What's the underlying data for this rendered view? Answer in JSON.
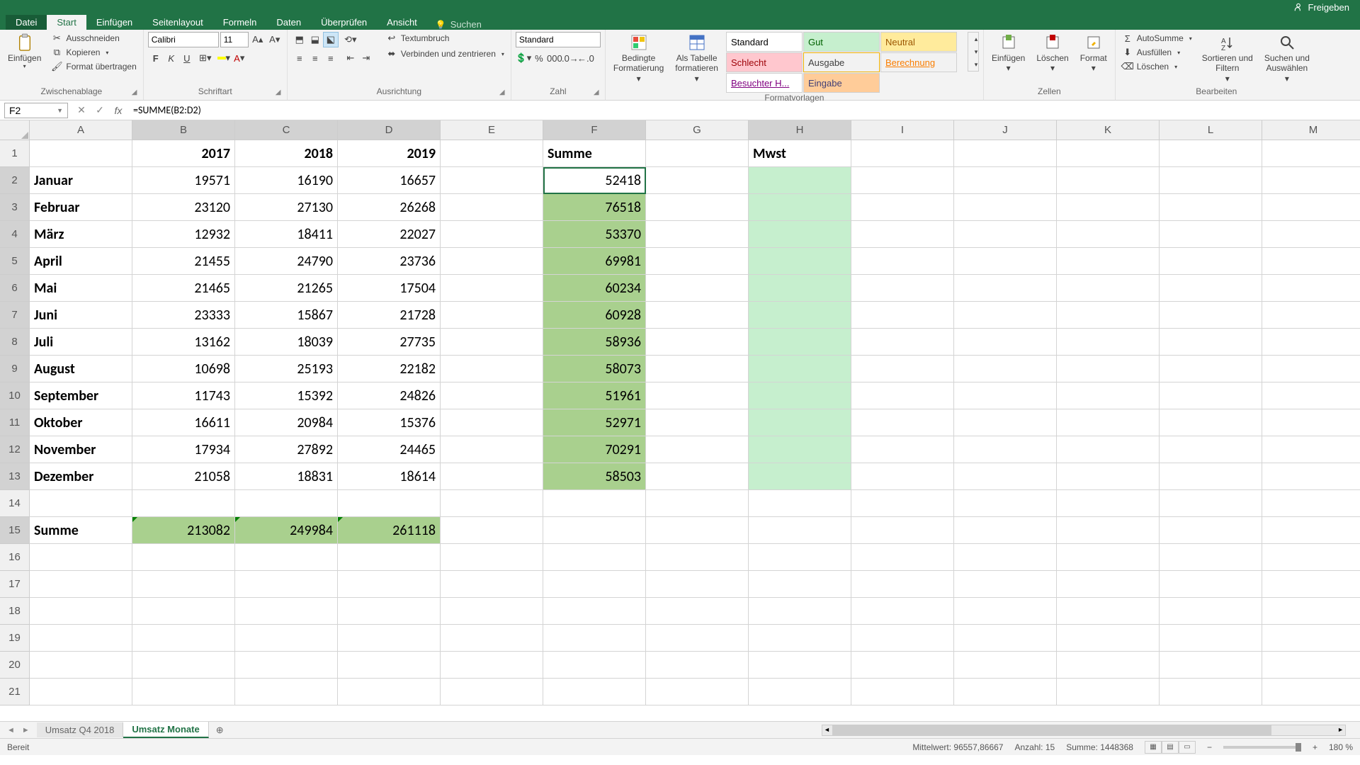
{
  "titlebar": {
    "share": "Freigeben"
  },
  "tabs": {
    "file": "Datei",
    "start": "Start",
    "insert": "Einfügen",
    "pagelayout": "Seitenlayout",
    "formulas": "Formeln",
    "data": "Daten",
    "review": "Überprüfen",
    "view": "Ansicht",
    "search_placeholder": "Suchen"
  },
  "ribbon": {
    "clipboard": {
      "paste": "Einfügen",
      "cut": "Ausschneiden",
      "copy": "Kopieren",
      "format_painter": "Format übertragen",
      "label": "Zwischenablage"
    },
    "font": {
      "name": "Calibri",
      "size": "11",
      "label": "Schriftart"
    },
    "alignment": {
      "wrap": "Textumbruch",
      "merge": "Verbinden und zentrieren",
      "label": "Ausrichtung"
    },
    "number": {
      "format": "Standard",
      "label": "Zahl"
    },
    "styles": {
      "cond_format": "Bedingte\nFormatierung",
      "as_table": "Als Tabelle\nformatieren",
      "cells_items": [
        {
          "label": "Standard",
          "bg": "#fff",
          "fg": "#000",
          "hover": false
        },
        {
          "label": "Gut",
          "bg": "#c6efce",
          "fg": "#006100",
          "hover": false
        },
        {
          "label": "Neutral",
          "bg": "#ffeb9c",
          "fg": "#9c5700",
          "hover": false
        },
        {
          "label": "Schlecht",
          "bg": "#ffc7ce",
          "fg": "#9c0006",
          "hover": false
        },
        {
          "label": "Ausgabe",
          "bg": "#f2f2f2",
          "fg": "#3f3f3f",
          "hover": true
        },
        {
          "label": "Berechnung",
          "bg": "#f2f2f2",
          "fg": "#fa7d00",
          "hover": false
        },
        {
          "label": "Besuchter H...",
          "bg": "#fff",
          "fg": "#800080",
          "hover": false
        },
        {
          "label": "Eingabe",
          "bg": "#ffcc99",
          "fg": "#3f3f76",
          "hover": false
        }
      ],
      "label": "Formatvorlagen"
    },
    "cells_grp": {
      "insert": "Einfügen",
      "delete": "Löschen",
      "format": "Format",
      "label": "Zellen"
    },
    "editing": {
      "autosum": "AutoSumme",
      "fill": "Ausfüllen",
      "clear": "Löschen",
      "sort": "Sortieren und\nFiltern",
      "find": "Suchen und\nAuswählen",
      "label": "Bearbeiten"
    }
  },
  "namebox": "F2",
  "formula": "=SUMME(B2:D2)",
  "columns": [
    "A",
    "B",
    "C",
    "D",
    "E",
    "F",
    "G",
    "H",
    "I",
    "J",
    "K",
    "L",
    "M"
  ],
  "sel_cols": [
    "B",
    "C",
    "D",
    "F",
    "H"
  ],
  "sel_rows": [
    2,
    3,
    4,
    5,
    6,
    7,
    8,
    9,
    10,
    11,
    12,
    13,
    15
  ],
  "rows": [
    {
      "r": 1,
      "A": "",
      "B": "2017",
      "C": "2018",
      "D": "2019",
      "E": "",
      "F": "Summe",
      "G": "",
      "H": "Mwst"
    },
    {
      "r": 2,
      "A": "Januar",
      "B": "19571",
      "C": "16190",
      "D": "16657",
      "E": "",
      "F": "52418"
    },
    {
      "r": 3,
      "A": "Februar",
      "B": "23120",
      "C": "27130",
      "D": "26268",
      "E": "",
      "F": "76518"
    },
    {
      "r": 4,
      "A": "März",
      "B": "12932",
      "C": "18411",
      "D": "22027",
      "E": "",
      "F": "53370"
    },
    {
      "r": 5,
      "A": "April",
      "B": "21455",
      "C": "24790",
      "D": "23736",
      "E": "",
      "F": "69981"
    },
    {
      "r": 6,
      "A": "Mai",
      "B": "21465",
      "C": "21265",
      "D": "17504",
      "E": "",
      "F": "60234"
    },
    {
      "r": 7,
      "A": "Juni",
      "B": "23333",
      "C": "15867",
      "D": "21728",
      "E": "",
      "F": "60928"
    },
    {
      "r": 8,
      "A": "Juli",
      "B": "13162",
      "C": "18039",
      "D": "27735",
      "E": "",
      "F": "58936"
    },
    {
      "r": 9,
      "A": "August",
      "B": "10698",
      "C": "25193",
      "D": "22182",
      "E": "",
      "F": "58073"
    },
    {
      "r": 10,
      "A": "September",
      "B": "11743",
      "C": "15392",
      "D": "24826",
      "E": "",
      "F": "51961"
    },
    {
      "r": 11,
      "A": "Oktober",
      "B": "16611",
      "C": "20984",
      "D": "15376",
      "E": "",
      "F": "52971"
    },
    {
      "r": 12,
      "A": "November",
      "B": "17934",
      "C": "27892",
      "D": "24465",
      "E": "",
      "F": "70291"
    },
    {
      "r": 13,
      "A": "Dezember",
      "B": "21058",
      "C": "18831",
      "D": "18614",
      "E": "",
      "F": "58503"
    },
    {
      "r": 14
    },
    {
      "r": 15,
      "A": "Summe",
      "B": "213082",
      "C": "249984",
      "D": "261118"
    },
    {
      "r": 16
    },
    {
      "r": 17
    },
    {
      "r": 18
    },
    {
      "r": 19
    },
    {
      "r": 20
    },
    {
      "r": 21
    }
  ],
  "sheets": {
    "nav": "◄ ►",
    "tab1": "Umsatz Q4 2018",
    "tab2": "Umsatz Monate"
  },
  "status": {
    "ready": "Bereit",
    "avg": "Mittelwert: 96557,86667",
    "count": "Anzahl: 15",
    "sum": "Summe: 1448368",
    "zoom": "180 %"
  }
}
